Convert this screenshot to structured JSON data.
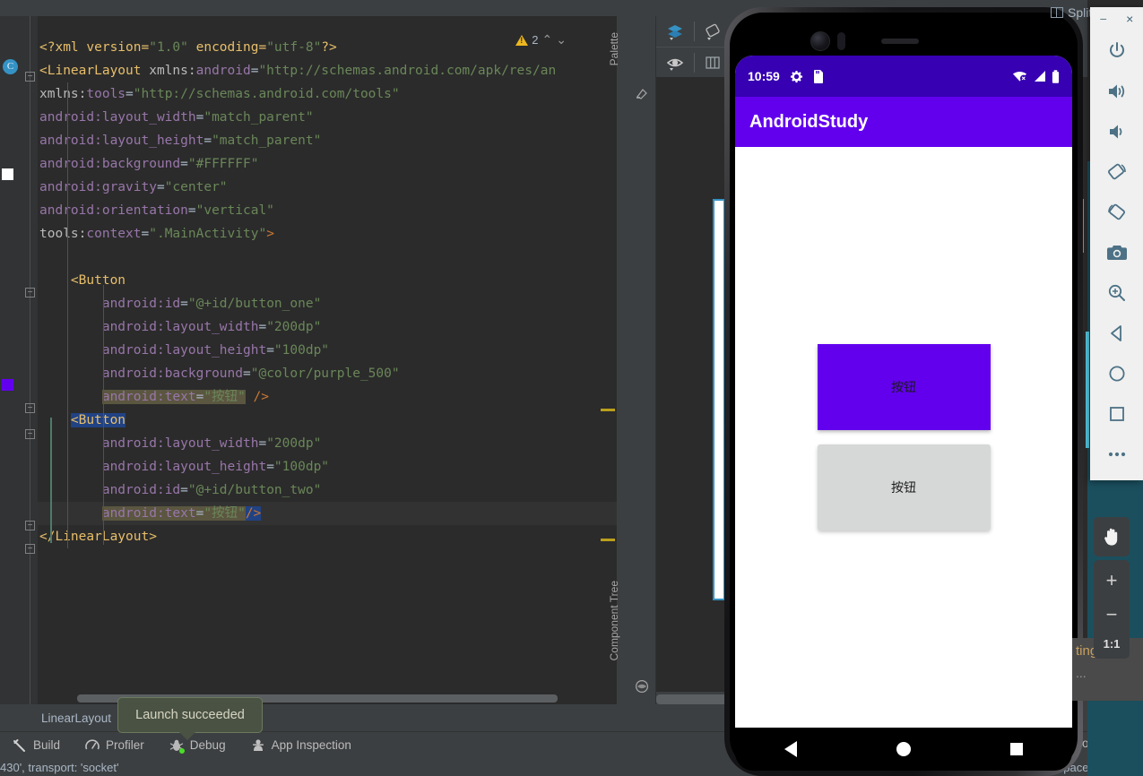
{
  "editor": {
    "warning_count": "2",
    "code_lines": [
      {
        "segs": [
          {
            "t": "<?xml version=",
            "c": "tag"
          },
          {
            "t": "\"1.0\"",
            "c": "str"
          },
          {
            "t": " encoding=",
            "c": "tag"
          },
          {
            "t": "\"utf-8\"",
            "c": "str"
          },
          {
            "t": "?>",
            "c": "tag"
          }
        ]
      },
      {
        "segs": [
          {
            "t": "<LinearLayout",
            "c": "tag"
          },
          {
            "t": " xmlns:",
            "c": "attr"
          },
          {
            "t": "android",
            "c": "ns"
          },
          {
            "t": "=",
            "c": "pnct"
          },
          {
            "t": "\"http://schemas.android.com/apk/res/an",
            "c": "str"
          }
        ]
      },
      {
        "segs": [
          {
            "t": "xmlns:",
            "c": "attr"
          },
          {
            "t": "tools",
            "c": "ns"
          },
          {
            "t": "=",
            "c": "pnct"
          },
          {
            "t": "\"http://schemas.android.com/tools\"",
            "c": "str"
          }
        ]
      },
      {
        "segs": [
          {
            "t": "android:",
            "c": "ns"
          },
          {
            "t": "layout_width",
            "c": "ns"
          },
          {
            "t": "=",
            "c": "pnct"
          },
          {
            "t": "\"match_parent\"",
            "c": "str"
          }
        ]
      },
      {
        "segs": [
          {
            "t": "android:",
            "c": "ns"
          },
          {
            "t": "layout_height",
            "c": "ns"
          },
          {
            "t": "=",
            "c": "pnct"
          },
          {
            "t": "\"match_parent\"",
            "c": "str"
          }
        ]
      },
      {
        "segs": [
          {
            "t": "android:",
            "c": "ns"
          },
          {
            "t": "background",
            "c": "ns"
          },
          {
            "t": "=",
            "c": "pnct"
          },
          {
            "t": "\"#FFFFFF\"",
            "c": "str"
          }
        ]
      },
      {
        "segs": [
          {
            "t": "android:",
            "c": "ns"
          },
          {
            "t": "gravity",
            "c": "ns"
          },
          {
            "t": "=",
            "c": "pnct"
          },
          {
            "t": "\"center\"",
            "c": "str"
          }
        ]
      },
      {
        "segs": [
          {
            "t": "android:",
            "c": "ns"
          },
          {
            "t": "orientation",
            "c": "ns"
          },
          {
            "t": "=",
            "c": "pnct"
          },
          {
            "t": "\"vertical\"",
            "c": "str"
          }
        ]
      },
      {
        "segs": [
          {
            "t": "tools:",
            "c": "attr"
          },
          {
            "t": "context",
            "c": "ns"
          },
          {
            "t": "=",
            "c": "pnct"
          },
          {
            "t": "\".MainActivity\"",
            "c": "str"
          },
          {
            "t": ">",
            "c": "op"
          }
        ]
      },
      {
        "segs": []
      },
      {
        "segs": [
          {
            "t": "    <Button",
            "c": "tag"
          }
        ]
      },
      {
        "segs": [
          {
            "t": "        android:",
            "c": "ns"
          },
          {
            "t": "id",
            "c": "ns"
          },
          {
            "t": "=",
            "c": "pnct"
          },
          {
            "t": "\"@+id/button_one\"",
            "c": "str"
          }
        ]
      },
      {
        "segs": [
          {
            "t": "        android:",
            "c": "ns"
          },
          {
            "t": "layout_width",
            "c": "ns"
          },
          {
            "t": "=",
            "c": "pnct"
          },
          {
            "t": "\"200dp\"",
            "c": "str"
          }
        ]
      },
      {
        "segs": [
          {
            "t": "        android:",
            "c": "ns"
          },
          {
            "t": "layout_height",
            "c": "ns"
          },
          {
            "t": "=",
            "c": "pnct"
          },
          {
            "t": "\"100dp\"",
            "c": "str"
          }
        ]
      },
      {
        "segs": [
          {
            "t": "        android:",
            "c": "ns"
          },
          {
            "t": "background",
            "c": "ns"
          },
          {
            "t": "=",
            "c": "pnct"
          },
          {
            "t": "\"@color/purple_500\"",
            "c": "str"
          }
        ]
      },
      {
        "segs": [
          {
            "t": "        ",
            "c": "pnct"
          },
          {
            "t": "android:",
            "c": "ns hl"
          },
          {
            "t": "text",
            "c": "ns hl"
          },
          {
            "t": "=",
            "c": "pnct hl"
          },
          {
            "t": "\"按钮\"",
            "c": "str hl"
          },
          {
            "t": " />",
            "c": "op"
          }
        ]
      },
      {
        "segs": [
          {
            "t": "    ",
            "c": "pnct"
          },
          {
            "t": "<Button",
            "c": "tag sel"
          }
        ]
      },
      {
        "segs": [
          {
            "t": "        android:",
            "c": "ns"
          },
          {
            "t": "layout_width",
            "c": "ns"
          },
          {
            "t": "=",
            "c": "pnct"
          },
          {
            "t": "\"200dp\"",
            "c": "str"
          }
        ]
      },
      {
        "segs": [
          {
            "t": "        android:",
            "c": "ns"
          },
          {
            "t": "layout_height",
            "c": "ns"
          },
          {
            "t": "=",
            "c": "pnct"
          },
          {
            "t": "\"100dp\"",
            "c": "str"
          }
        ]
      },
      {
        "segs": [
          {
            "t": "        android:",
            "c": "ns"
          },
          {
            "t": "id",
            "c": "ns"
          },
          {
            "t": "=",
            "c": "pnct"
          },
          {
            "t": "\"@+id/button_two\"",
            "c": "str"
          }
        ]
      },
      {
        "segs": [
          {
            "t": "        ",
            "c": "pnct"
          },
          {
            "t": "android:",
            "c": "ns hl"
          },
          {
            "t": "text",
            "c": "ns hl"
          },
          {
            "t": "=",
            "c": "pnct hl"
          },
          {
            "t": "\"按钮\"",
            "c": "str hl"
          },
          {
            "t": "/>",
            "c": "op sel"
          }
        ]
      },
      {
        "segs": [
          {
            "t": "</LinearLayout>",
            "c": "tag"
          }
        ]
      }
    ],
    "breadcrumb": "LinearLayout"
  },
  "design": {
    "palette_label": "Palette",
    "component_tree_label": "Component Tree",
    "toolbar_icons": [
      "layers-icon",
      "orientation-icon",
      "eye-icon",
      "columns-icon"
    ]
  },
  "split_label": "Split",
  "tooltip": {
    "text": "Launch succeeded"
  },
  "emulator": {
    "status_bar": {
      "time": "10:59",
      "icons": [
        "gear-icon",
        "sdcard-icon",
        "wifi-off-icon",
        "signal-icon",
        "battery-icon"
      ]
    },
    "app_title": "AndroidStudy",
    "buttons": [
      {
        "label": "按钮",
        "style": "purple"
      },
      {
        "label": "按钮",
        "style": "grey"
      }
    ],
    "nav_icons": [
      "back-icon",
      "home-icon",
      "recents-icon"
    ],
    "toolbar_buttons": [
      "power-icon",
      "volume-up-icon",
      "volume-down-icon",
      "rotate-left-icon",
      "rotate-right-icon",
      "screenshot-icon",
      "zoom-icon",
      "back-icon",
      "home-icon",
      "overview-icon",
      "more-icon"
    ],
    "window_controls": {
      "minimize": "−",
      "close": "×"
    },
    "zoom_controls": {
      "zoom_in": "+",
      "zoom_out": "−",
      "ratio": "1:1"
    },
    "pan_icon": "hand-icon"
  },
  "popup": {
    "line1": "ting",
    "line2": "..."
  },
  "bottom_bar": {
    "items": [
      {
        "label": "Build",
        "icon": "hammer-icon"
      },
      {
        "label": "Profiler",
        "icon": "gauge-icon"
      },
      {
        "label": "Debug",
        "icon": "bug-icon",
        "running": true
      },
      {
        "label": "App Inspection",
        "icon": "inspection-icon"
      }
    ],
    "right_text": "out Inspect"
  },
  "status_bar": {
    "message": "430', transport: 'socket'",
    "right_text": "paces",
    "lock_icon": "lock-open-icon"
  },
  "colors": {
    "accent_purple": "#6200EE",
    "status_purple": "#3700B3",
    "ide_bg": "#3C3F41",
    "editor_bg": "#2B2B2B",
    "warning_yellow": "#EDB71E"
  }
}
